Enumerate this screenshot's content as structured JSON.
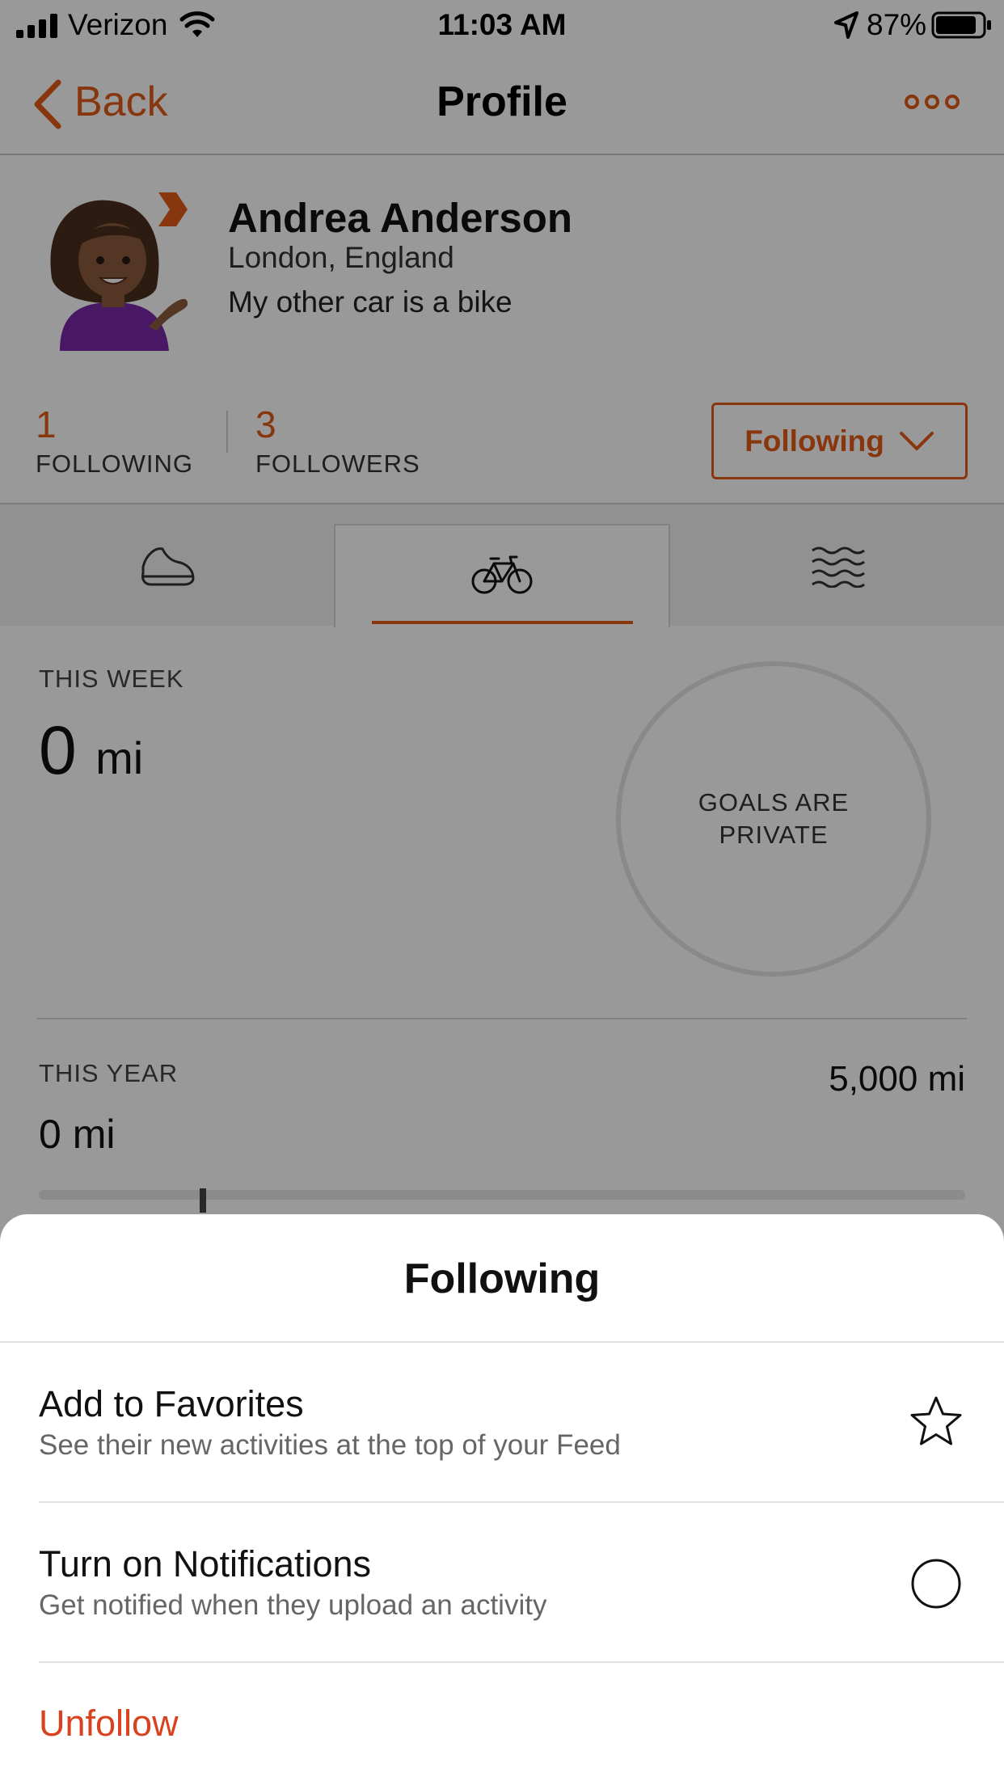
{
  "status_bar": {
    "carrier": "Verizon",
    "time": "11:03 AM",
    "battery_percent": "87%",
    "battery_level": 0.87
  },
  "nav": {
    "back_label": "Back",
    "title": "Profile",
    "more_icon": "more-icon"
  },
  "profile": {
    "name": "Andrea Anderson",
    "location": "London, England",
    "bio": "My other car is a bike"
  },
  "stats": {
    "following_count": "1",
    "following_label": "FOLLOWING",
    "followers_count": "3",
    "followers_label": "FOLLOWERS"
  },
  "follow_button": {
    "label": "Following"
  },
  "tabs": [
    {
      "icon": "running-shoe-icon",
      "active": false
    },
    {
      "icon": "bike-icon",
      "active": true
    },
    {
      "icon": "swim-waves-icon",
      "active": false
    }
  ],
  "week": {
    "label": "THIS WEEK",
    "value": "0",
    "unit": "mi",
    "goal_line1": "GOALS ARE",
    "goal_line2": "PRIVATE"
  },
  "year": {
    "label": "THIS YEAR",
    "value": "0 mi",
    "goal": "5,000 mi"
  },
  "sheet": {
    "title": "Following",
    "favorites_title": "Add to Favorites",
    "favorites_subtitle": "See their new activities at the top of your Feed",
    "notifications_title": "Turn on Notifications",
    "notifications_subtitle": "Get notified when they upload an activity",
    "unfollow_label": "Unfollow"
  },
  "colors": {
    "accent": "#e35a16",
    "destructive": "#d8421e"
  }
}
